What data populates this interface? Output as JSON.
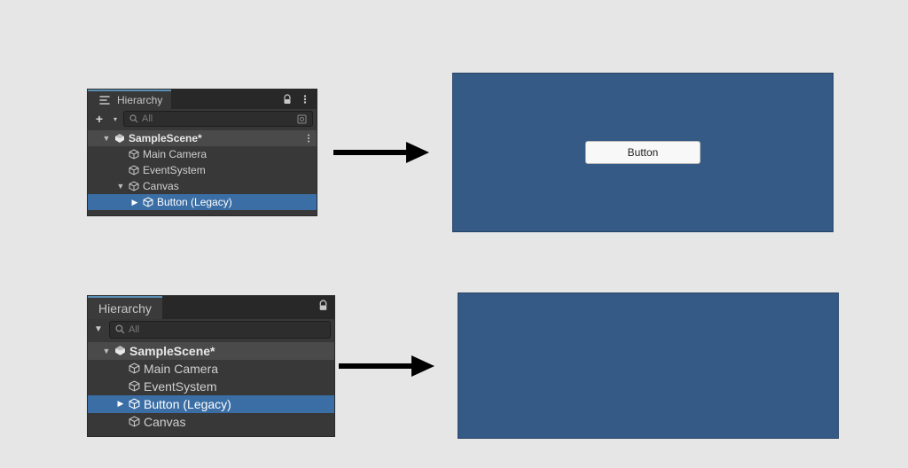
{
  "panel1": {
    "tab_label": "Hierarchy",
    "search_placeholder": "All",
    "scene_name": "SampleScene*",
    "items": [
      {
        "label": "Main Camera"
      },
      {
        "label": "EventSystem"
      },
      {
        "label": "Canvas"
      },
      {
        "label": "Button (Legacy)"
      }
    ]
  },
  "panel2": {
    "tab_label": "Hierarchy",
    "search_placeholder": "All",
    "scene_name": "SampleScene*",
    "items": [
      {
        "label": "Main Camera"
      },
      {
        "label": "EventSystem"
      },
      {
        "label": "Button (Legacy)"
      },
      {
        "label": "Canvas"
      }
    ]
  },
  "game": {
    "button_label": "Button"
  }
}
